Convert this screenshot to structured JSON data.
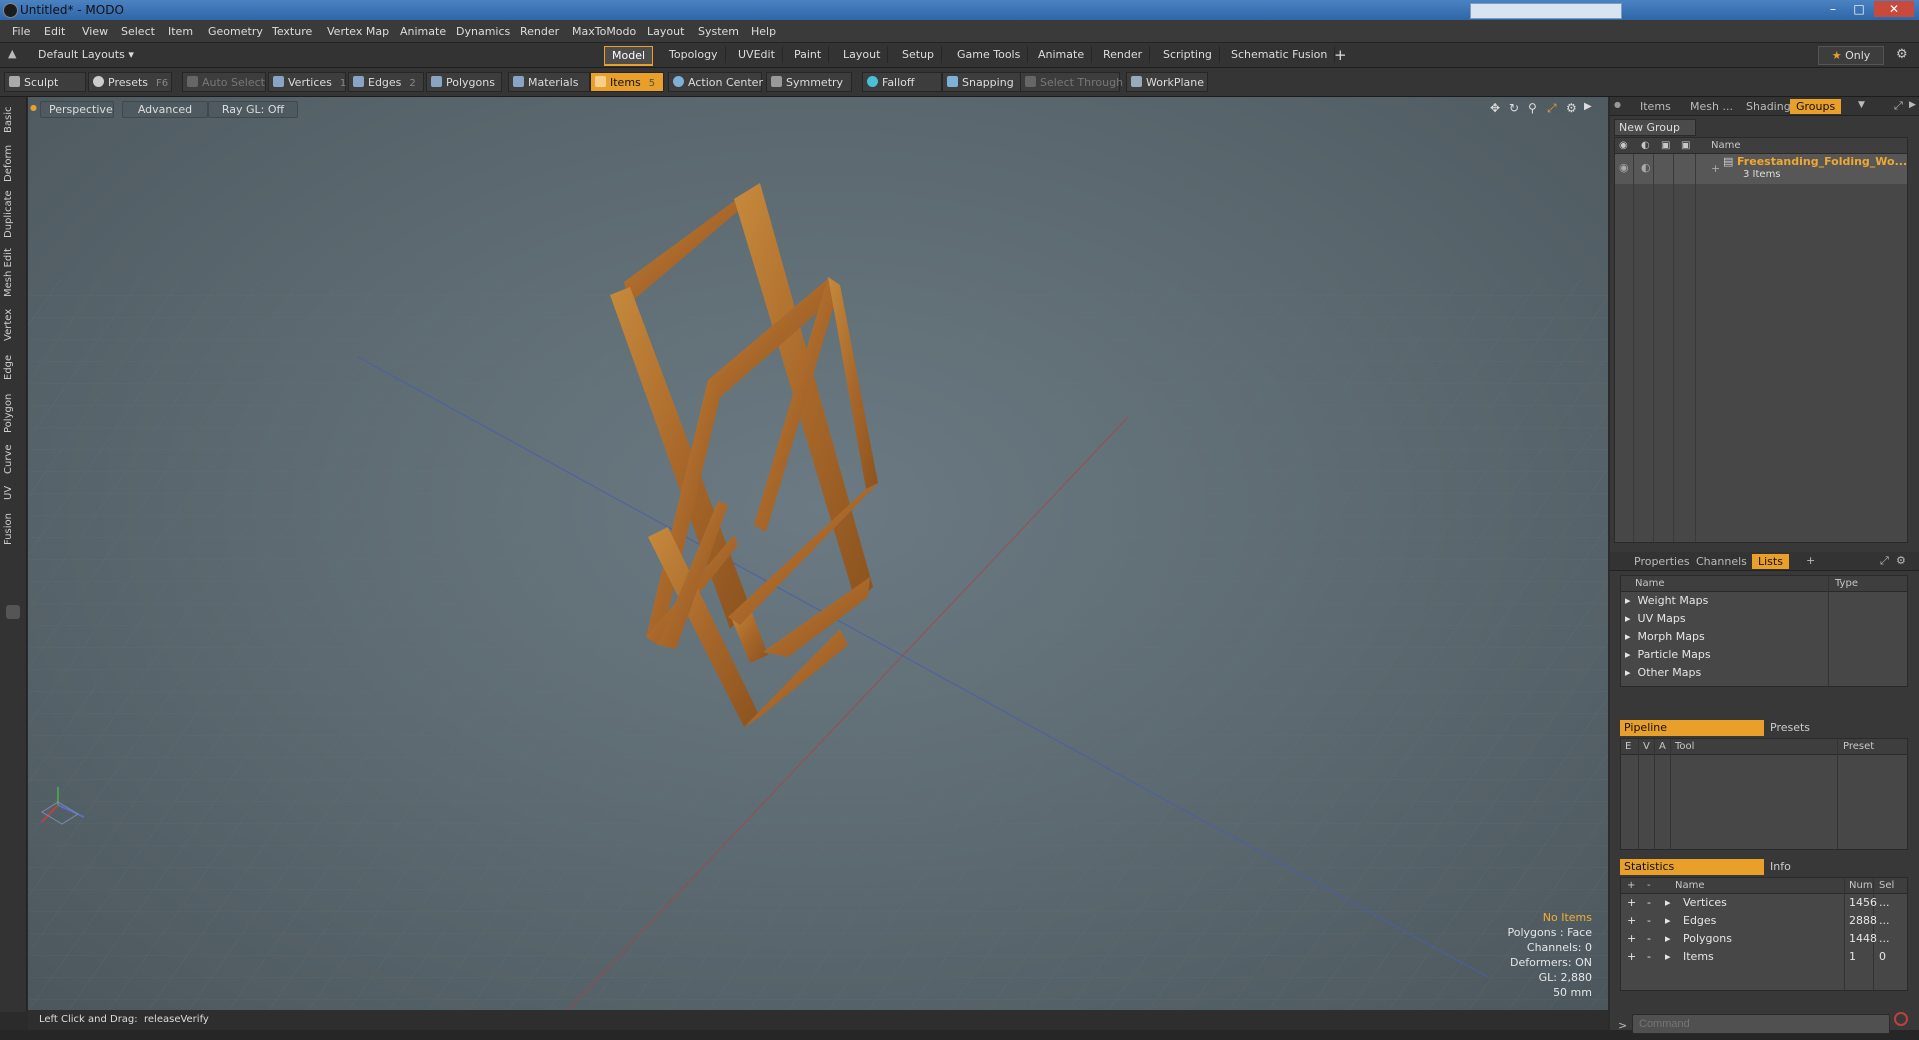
{
  "window": {
    "title": "Untitled* - MODO"
  },
  "menu": [
    "File",
    "Edit",
    "View",
    "Select",
    "Item",
    "Geometry",
    "Texture",
    "Vertex Map",
    "Animate",
    "Dynamics",
    "Render",
    "MaxToModo",
    "Layout",
    "System",
    "Help"
  ],
  "layouts": {
    "label": "Default Layouts",
    "tabs": [
      "Model",
      "Topology",
      "UVEdit",
      "Paint",
      "Layout",
      "Setup",
      "Game Tools",
      "Animate",
      "Render",
      "Scripting",
      "Schematic Fusion"
    ],
    "active": "Model",
    "only_label": "Only"
  },
  "toolbar": {
    "sculpt": "Sculpt",
    "presets": "Presets",
    "presets_key": "F6",
    "auto_select": "Auto Select",
    "vertices": "Vertices",
    "vertices_key": "1",
    "edges": "Edges",
    "edges_key": "2",
    "polygons": "Polygons",
    "materials": "Materials",
    "items": "Items",
    "items_key": "5",
    "action_center": "Action Center",
    "symmetry": "Symmetry",
    "falloff": "Falloff",
    "snapping": "Snapping",
    "select_through": "Select Through",
    "workplane": "WorkPlane"
  },
  "left_tabs": [
    "Basic",
    "Deform",
    "Duplicate",
    "Mesh Edit",
    "Vertex",
    "Edge",
    "Polygon",
    "Curve",
    "UV",
    "Fusion"
  ],
  "viewport": {
    "view": "Perspective",
    "shading": "Advanced",
    "raygl": "Ray GL: Off",
    "stats": {
      "items": "No Items",
      "polygons": "Polygons : Face",
      "channels": "Channels: 0",
      "deformers": "Deformers: ON",
      "gl": "GL: 2,880",
      "size": "50 mm"
    }
  },
  "status": {
    "hint": "Left Click and Drag:",
    "action": "releaseVerify"
  },
  "groups_panel": {
    "tabs": [
      "Items",
      "Mesh ...",
      "Shading",
      "Groups"
    ],
    "active": "Groups",
    "new_group": "New Group",
    "name_header": "Name",
    "group_name": "Freestanding_Folding_Wo...",
    "group_count": "3 Items"
  },
  "lists_panel": {
    "tabs": [
      "Properties",
      "Channels",
      "Lists"
    ],
    "active": "Lists",
    "headers": [
      "Name",
      "Type"
    ],
    "rows": [
      "Weight Maps",
      "UV Maps",
      "Morph Maps",
      "Particle Maps",
      "Other Maps"
    ]
  },
  "pipeline_panel": {
    "tabs": [
      "Pipeline",
      "Presets"
    ],
    "headers": [
      "E",
      "V",
      "A",
      "Tool",
      "Preset"
    ]
  },
  "statistics_panel": {
    "tabs": [
      "Statistics",
      "Info"
    ],
    "headers": [
      "Name",
      "Num",
      "Sel"
    ],
    "rows": [
      {
        "name": "Vertices",
        "num": "1456",
        "sel": "..."
      },
      {
        "name": "Edges",
        "num": "2888",
        "sel": "..."
      },
      {
        "name": "Polygons",
        "num": "1448",
        "sel": "..."
      },
      {
        "name": "Items",
        "num": "1",
        "sel": "0"
      }
    ]
  },
  "command": {
    "placeholder": "Command"
  },
  "colors": {
    "accent": "#e8a02b",
    "wood": "#b8762a",
    "viewport": "#5f6c73"
  }
}
